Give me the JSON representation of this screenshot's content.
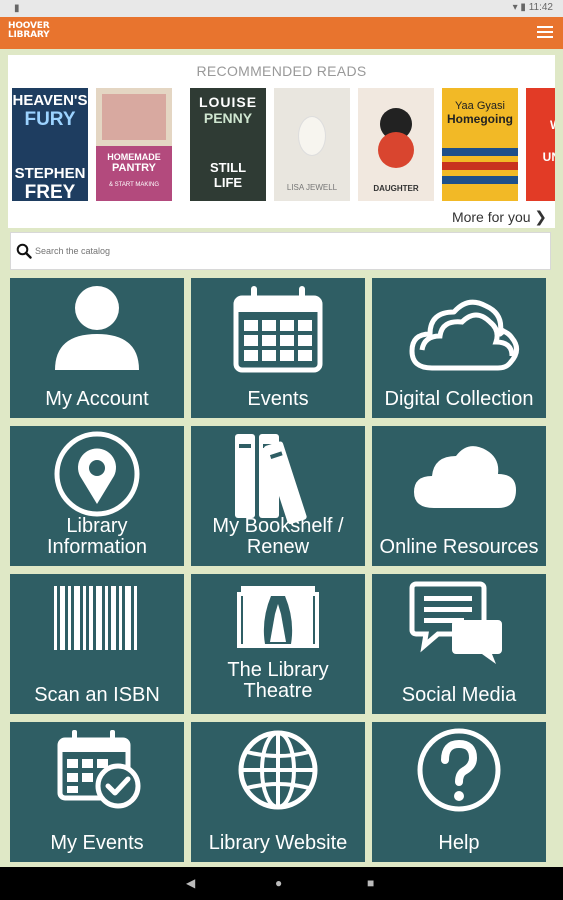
{
  "status_bar": {
    "time": "11:42"
  },
  "header": {
    "logo_line1": "HOOVER",
    "logo_line2": "LIBRARY"
  },
  "recommended": {
    "title": "RECOMMENDED READS",
    "more_label": "More for you",
    "books": [
      {
        "line1": "HEAVEN'S",
        "line2": "FURY",
        "line3": "STEPHEN",
        "line4": "FREY",
        "bg": "#1e3d60"
      },
      {
        "line1": "HOMEMADE",
        "line2": "PANTRY",
        "line3": "& START MAKING",
        "line4": "",
        "bg": "#b34a7d"
      },
      {
        "line1": "LOUISE",
        "line2": "PENNY",
        "line3": "STILL",
        "line4": "LIFE",
        "bg": "#2f3b34"
      },
      {
        "line1": "LISA JEWELL",
        "line2": "",
        "line3": "",
        "line4": "",
        "bg": "#e9e6df"
      },
      {
        "line1": "DAUGHTER",
        "line2": "",
        "line3": "",
        "line4": "",
        "bg": "#f1e8df"
      },
      {
        "line1": "Yaa Gyasi",
        "line2": "Homegoing",
        "line3": "",
        "line4": "",
        "bg": "#f2b926"
      },
      {
        "line1": "WHY",
        "line2": "UNDER",
        "line3": "",
        "line4": "",
        "bg": "#e23b26"
      }
    ]
  },
  "search": {
    "placeholder": "Search the catalog"
  },
  "tiles": [
    {
      "label": "My Account",
      "icon": "person-icon"
    },
    {
      "label": "Events",
      "icon": "calendar-icon"
    },
    {
      "label": "Digital Collection",
      "icon": "cloud-outline-icon"
    },
    {
      "label": "Library Information",
      "icon": "map-pin-icon"
    },
    {
      "label": "My Bookshelf / Renew",
      "icon": "books-icon"
    },
    {
      "label": "Online Resources",
      "icon": "cloud-icon"
    },
    {
      "label": "Scan an ISBN",
      "icon": "barcode-icon"
    },
    {
      "label": "The Library Theatre",
      "icon": "theatre-icon"
    },
    {
      "label": "Social Media",
      "icon": "chat-bubbles-icon"
    },
    {
      "label": "My Events",
      "icon": "calendar-check-icon"
    },
    {
      "label": "Library Website",
      "icon": "globe-icon"
    },
    {
      "label": "Help",
      "icon": "question-icon"
    }
  ],
  "colors": {
    "header": "#e8742e",
    "tile": "#2f5e64",
    "background": "#dfe8c6"
  }
}
